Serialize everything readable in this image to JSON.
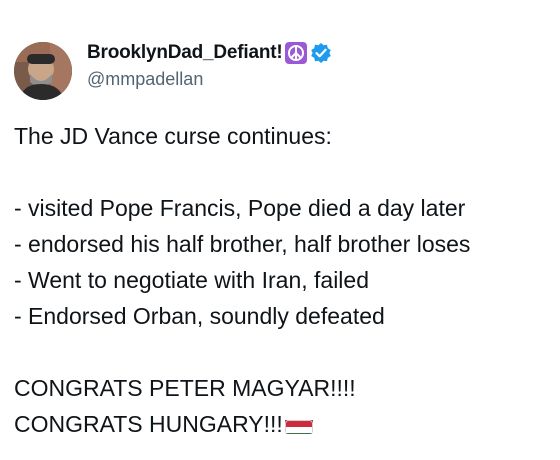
{
  "user": {
    "display_name": "BrooklynDad_Defiant!",
    "handle": "@mmpadellan",
    "icons": [
      "peace-symbol-icon",
      "verified-badge-icon"
    ],
    "verified_color": "#1d9bf0",
    "peace_color": "#9b59d6"
  },
  "tweet": {
    "lines": [
      "The JD Vance curse continues:",
      "- visited Pope Francis, Pope died a day later",
      "- endorsed his half brother, half brother loses",
      "- Went to negotiate with Iran, failed",
      "- Endorsed Orban, soundly defeated",
      "CONGRATS PETER MAGYAR!!!!",
      "CONGRATS HUNGARY!!!"
    ],
    "emoji": "hungary-flag-icon"
  }
}
